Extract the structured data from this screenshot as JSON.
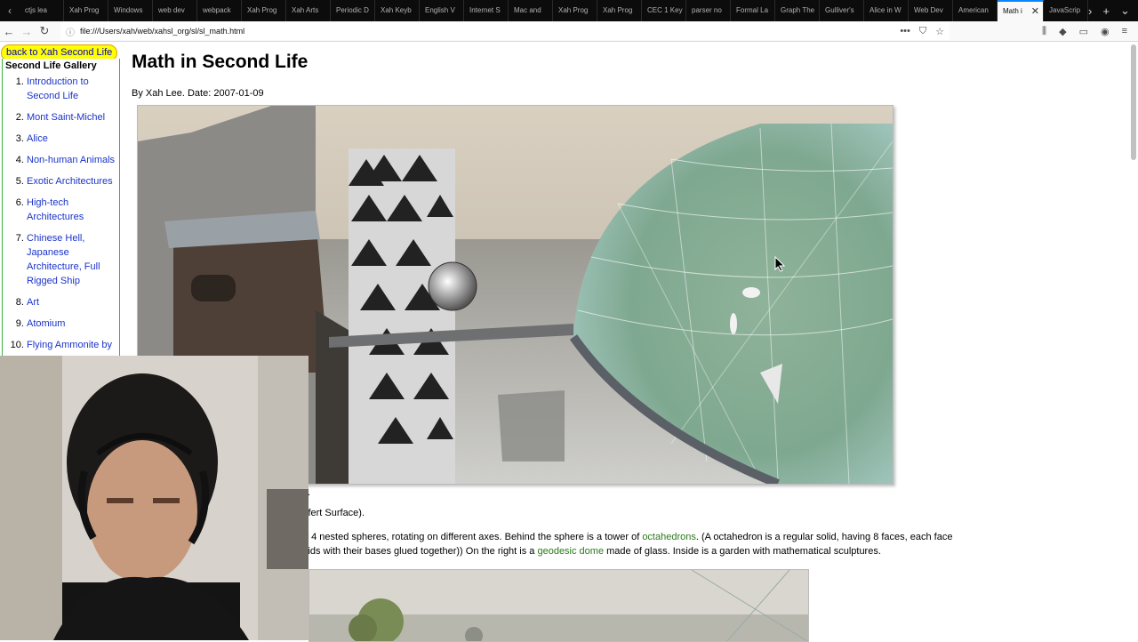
{
  "browser": {
    "tabs": [
      {
        "label": "ctjs lea"
      },
      {
        "label": "Xah Prog"
      },
      {
        "label": "Windows"
      },
      {
        "label": "web dev"
      },
      {
        "label": "webpack"
      },
      {
        "label": "Xah Prog"
      },
      {
        "label": "Xah Arts"
      },
      {
        "label": "Periodic D"
      },
      {
        "label": "Xah Keyb"
      },
      {
        "label": "English V"
      },
      {
        "label": "Internet S"
      },
      {
        "label": "Mac and"
      },
      {
        "label": "Xah Prog"
      },
      {
        "label": "Xah Prog"
      },
      {
        "label": "CEC 1 Key"
      },
      {
        "label": "parser no"
      },
      {
        "label": "Formal La"
      },
      {
        "label": "Graph The"
      },
      {
        "label": "Gulliver's"
      },
      {
        "label": "Alice in W"
      },
      {
        "label": "Web Dev"
      },
      {
        "label": "American"
      },
      {
        "label": "Math i",
        "active": true
      },
      {
        "label": "JavaScrip"
      }
    ],
    "url": "file:///Users/xah/web/xahsl_org/sl/sl_math.html"
  },
  "page": {
    "back_link": "back to Xah Second Life",
    "title": "Math in Second Life",
    "byline": "By Xah Lee. Date: 2007-01-09",
    "caption_dot": ".",
    "caption_line1": "ifert Surface).",
    "caption_line2_part1": "f 4 nested spheres, rotating on different axes. Behind the sphere is a tower of ",
    "caption_line2_link": "octahedrons",
    "caption_line2_part2": ". (A octahedron is a regular solid, having 8 faces, each face",
    "caption_line3_part1": "iids with their bases glued together)) On the right is a ",
    "caption_line3_link": "geodesic dome",
    "caption_line3_part2": " made of glass. Inside is a garden with mathematical sculptures."
  },
  "sidebar": {
    "title": "Second Life Gallery",
    "items": [
      {
        "label": "Introduction to Second Life"
      },
      {
        "label": "Mont Saint-Michel"
      },
      {
        "label": "Alice"
      },
      {
        "label": "Non-human Animals"
      },
      {
        "label": "Exotic Architectures"
      },
      {
        "label": "High-tech Architectures"
      },
      {
        "label": "Chinese Hell, Japanese Architecture, Full Rigged Ship"
      },
      {
        "label": "Art"
      },
      {
        "label": "Atomium"
      },
      {
        "label": "Flying Ammonite by"
      }
    ]
  },
  "colors": {
    "link": "#1a33c9",
    "green_link": "#2a7a1a",
    "back_link_bg": "#ffff00",
    "sidebar_border": "#3cb043",
    "active_tab_accent": "#0a84ff"
  }
}
